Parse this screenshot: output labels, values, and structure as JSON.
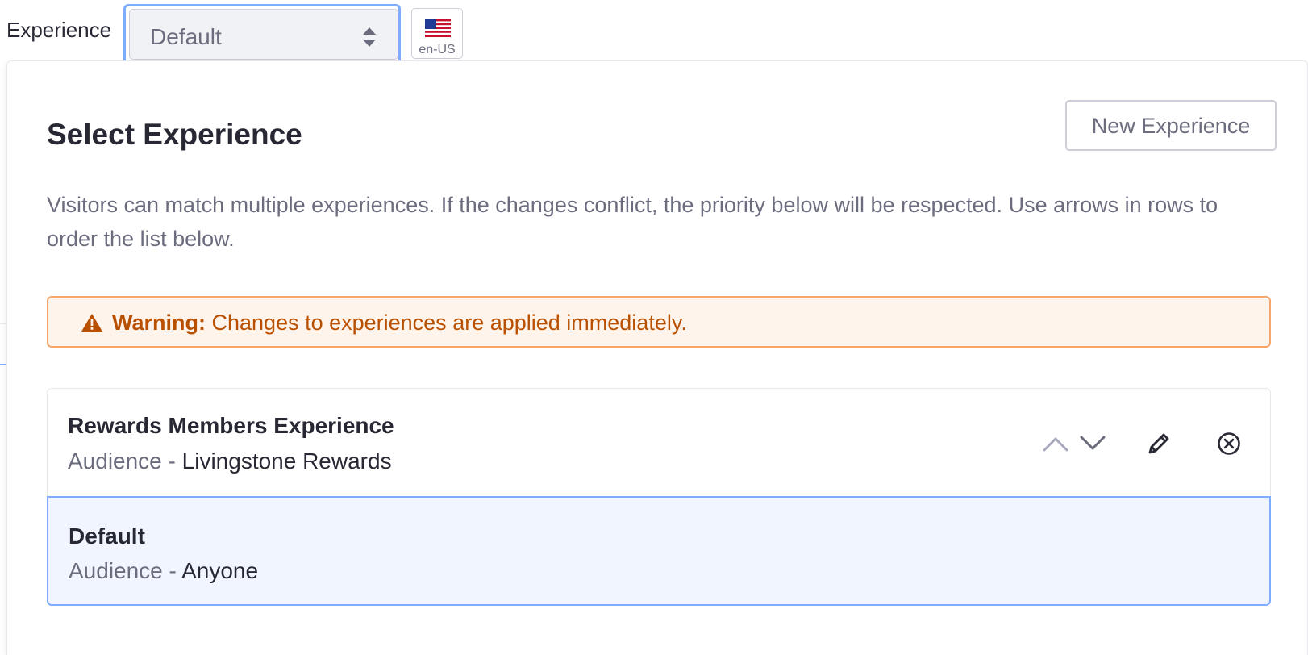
{
  "topbar": {
    "experience_label": "Experience",
    "select_value": "Default",
    "language_code": "en-US",
    "language_icon": "us-flag-icon"
  },
  "panel": {
    "title": "Select Experience",
    "new_experience_label": "New Experience",
    "description": "Visitors can match multiple experiences. If the changes conflict, the priority below will be respected. Use arrows in rows to order the list below.",
    "warning": {
      "title": "Warning:",
      "message": "Changes to experiences are applied immediately.",
      "icon": "warning-triangle-icon"
    },
    "experiences": [
      {
        "name": "Rewards Members Experience",
        "audience_label": "Audience",
        "separator": " - ",
        "audience": "Livingstone Rewards",
        "actions": [
          "chevron-up-icon",
          "chevron-down-icon",
          "pencil-icon",
          "times-circle-icon"
        ]
      },
      {
        "name": "Default",
        "audience_label": "Audience",
        "separator": " - ",
        "audience": "Anyone",
        "selected": true
      }
    ]
  },
  "colors": {
    "accent": "#80acff",
    "warning_text": "#b95000",
    "warning_bg": "#fff4ec",
    "warning_border": "#f5a66a",
    "selected_bg": "#f0f5ff"
  }
}
